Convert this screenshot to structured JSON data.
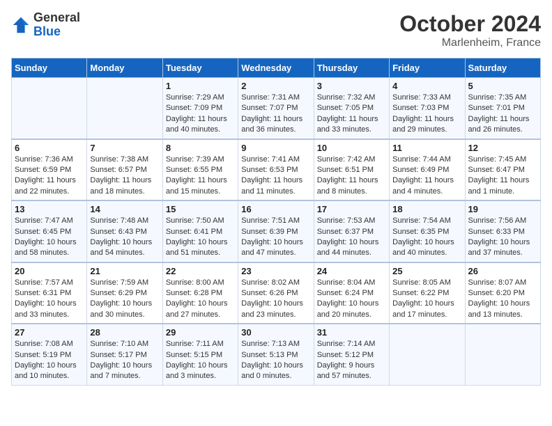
{
  "header": {
    "logo": {
      "general": "General",
      "blue": "Blue"
    },
    "month": "October 2024",
    "location": "Marlenheim, France"
  },
  "weekdays": [
    "Sunday",
    "Monday",
    "Tuesday",
    "Wednesday",
    "Thursday",
    "Friday",
    "Saturday"
  ],
  "weeks": [
    [
      {
        "day": "",
        "info": ""
      },
      {
        "day": "",
        "info": ""
      },
      {
        "day": "1",
        "info": "Sunrise: 7:29 AM\nSunset: 7:09 PM\nDaylight: 11 hours and 40 minutes."
      },
      {
        "day": "2",
        "info": "Sunrise: 7:31 AM\nSunset: 7:07 PM\nDaylight: 11 hours and 36 minutes."
      },
      {
        "day": "3",
        "info": "Sunrise: 7:32 AM\nSunset: 7:05 PM\nDaylight: 11 hours and 33 minutes."
      },
      {
        "day": "4",
        "info": "Sunrise: 7:33 AM\nSunset: 7:03 PM\nDaylight: 11 hours and 29 minutes."
      },
      {
        "day": "5",
        "info": "Sunrise: 7:35 AM\nSunset: 7:01 PM\nDaylight: 11 hours and 26 minutes."
      }
    ],
    [
      {
        "day": "6",
        "info": "Sunrise: 7:36 AM\nSunset: 6:59 PM\nDaylight: 11 hours and 22 minutes."
      },
      {
        "day": "7",
        "info": "Sunrise: 7:38 AM\nSunset: 6:57 PM\nDaylight: 11 hours and 18 minutes."
      },
      {
        "day": "8",
        "info": "Sunrise: 7:39 AM\nSunset: 6:55 PM\nDaylight: 11 hours and 15 minutes."
      },
      {
        "day": "9",
        "info": "Sunrise: 7:41 AM\nSunset: 6:53 PM\nDaylight: 11 hours and 11 minutes."
      },
      {
        "day": "10",
        "info": "Sunrise: 7:42 AM\nSunset: 6:51 PM\nDaylight: 11 hours and 8 minutes."
      },
      {
        "day": "11",
        "info": "Sunrise: 7:44 AM\nSunset: 6:49 PM\nDaylight: 11 hours and 4 minutes."
      },
      {
        "day": "12",
        "info": "Sunrise: 7:45 AM\nSunset: 6:47 PM\nDaylight: 11 hours and 1 minute."
      }
    ],
    [
      {
        "day": "13",
        "info": "Sunrise: 7:47 AM\nSunset: 6:45 PM\nDaylight: 10 hours and 58 minutes."
      },
      {
        "day": "14",
        "info": "Sunrise: 7:48 AM\nSunset: 6:43 PM\nDaylight: 10 hours and 54 minutes."
      },
      {
        "day": "15",
        "info": "Sunrise: 7:50 AM\nSunset: 6:41 PM\nDaylight: 10 hours and 51 minutes."
      },
      {
        "day": "16",
        "info": "Sunrise: 7:51 AM\nSunset: 6:39 PM\nDaylight: 10 hours and 47 minutes."
      },
      {
        "day": "17",
        "info": "Sunrise: 7:53 AM\nSunset: 6:37 PM\nDaylight: 10 hours and 44 minutes."
      },
      {
        "day": "18",
        "info": "Sunrise: 7:54 AM\nSunset: 6:35 PM\nDaylight: 10 hours and 40 minutes."
      },
      {
        "day": "19",
        "info": "Sunrise: 7:56 AM\nSunset: 6:33 PM\nDaylight: 10 hours and 37 minutes."
      }
    ],
    [
      {
        "day": "20",
        "info": "Sunrise: 7:57 AM\nSunset: 6:31 PM\nDaylight: 10 hours and 33 minutes."
      },
      {
        "day": "21",
        "info": "Sunrise: 7:59 AM\nSunset: 6:29 PM\nDaylight: 10 hours and 30 minutes."
      },
      {
        "day": "22",
        "info": "Sunrise: 8:00 AM\nSunset: 6:28 PM\nDaylight: 10 hours and 27 minutes."
      },
      {
        "day": "23",
        "info": "Sunrise: 8:02 AM\nSunset: 6:26 PM\nDaylight: 10 hours and 23 minutes."
      },
      {
        "day": "24",
        "info": "Sunrise: 8:04 AM\nSunset: 6:24 PM\nDaylight: 10 hours and 20 minutes."
      },
      {
        "day": "25",
        "info": "Sunrise: 8:05 AM\nSunset: 6:22 PM\nDaylight: 10 hours and 17 minutes."
      },
      {
        "day": "26",
        "info": "Sunrise: 8:07 AM\nSunset: 6:20 PM\nDaylight: 10 hours and 13 minutes."
      }
    ],
    [
      {
        "day": "27",
        "info": "Sunrise: 7:08 AM\nSunset: 5:19 PM\nDaylight: 10 hours and 10 minutes."
      },
      {
        "day": "28",
        "info": "Sunrise: 7:10 AM\nSunset: 5:17 PM\nDaylight: 10 hours and 7 minutes."
      },
      {
        "day": "29",
        "info": "Sunrise: 7:11 AM\nSunset: 5:15 PM\nDaylight: 10 hours and 3 minutes."
      },
      {
        "day": "30",
        "info": "Sunrise: 7:13 AM\nSunset: 5:13 PM\nDaylight: 10 hours and 0 minutes."
      },
      {
        "day": "31",
        "info": "Sunrise: 7:14 AM\nSunset: 5:12 PM\nDaylight: 9 hours and 57 minutes."
      },
      {
        "day": "",
        "info": ""
      },
      {
        "day": "",
        "info": ""
      }
    ]
  ]
}
